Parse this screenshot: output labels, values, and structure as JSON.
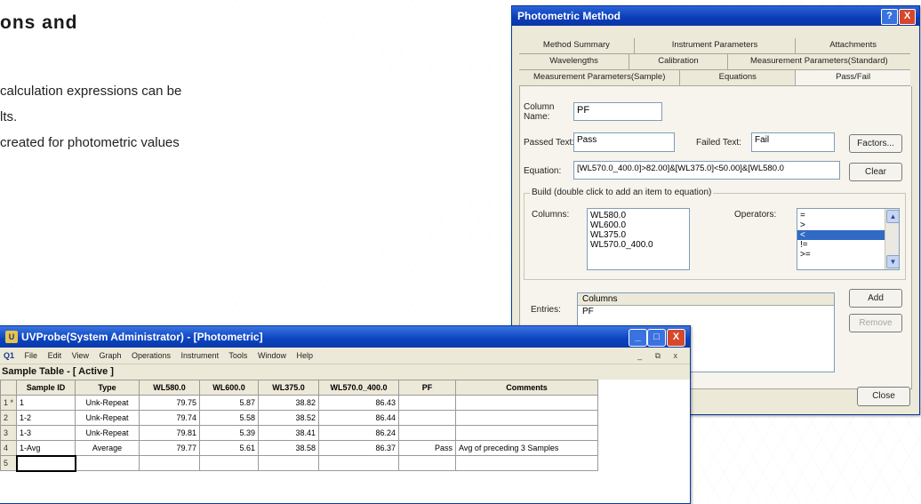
{
  "left": {
    "heading": "ons and",
    "lines": [
      "calculation expressions can be",
      "lts.",
      " created for photometric values"
    ]
  },
  "dialog": {
    "title": "Photometric Method",
    "help_glyph": "?",
    "close_glyph": "X",
    "tabs_row1": [
      "Method Summary",
      "Instrument Parameters",
      "Attachments"
    ],
    "tabs_row2": [
      "Wavelengths",
      "Calibration",
      "Measurement Parameters(Standard)"
    ],
    "tabs_row3": [
      "Measurement Parameters(Sample)",
      "Equations",
      "Pass/Fail"
    ],
    "column_name_label": "Column\nName:",
    "column_name_value": "PF",
    "passed_text_label": "Passed Text:",
    "passed_text_value": "Pass",
    "failed_text_label": "Failed Text:",
    "failed_text_value": "Fail",
    "factors_button": "Factors...",
    "equation_label": "Equation:",
    "equation_value": "[WL570.0_400.0]>82.00]&[WL375.0]<50.00]&[WL580.0",
    "clear_button": "Clear",
    "build_group_title": "Build (double click to add an item to equation)",
    "columns_label": "Columns:",
    "columns_items": [
      "WL580.0",
      "WL600.0",
      "WL375.0",
      "WL570.0_400.0"
    ],
    "operators_label": "Operators:",
    "operators_items": [
      "=",
      ">",
      "<",
      "!=",
      ">="
    ],
    "operators_selected": "<",
    "entries_label": "Entries:",
    "entries_header": "Columns",
    "entries_items": [
      "PF"
    ],
    "add_button": "Add",
    "remove_button": "Remove",
    "close_button": "Close"
  },
  "uvprobe": {
    "title": "UVProbe(System Administrator) - [Photometric]",
    "app_icon_glyph": "U",
    "minimize_glyph": "_",
    "maximize_glyph": "□",
    "close_glyph": "X",
    "menu": [
      "File",
      "Edit",
      "View",
      "Graph",
      "Operations",
      "Instrument",
      "Tools",
      "Window",
      "Help"
    ],
    "menu_icon": "Q1",
    "mdi_controls": "_ ⧉ x",
    "sheet_title": "Sample Table - [ Active ]",
    "columns": [
      "",
      "Sample ID",
      "Type",
      "WL580.0",
      "WL600.0",
      "WL375.0",
      "WL570.0_400.0",
      "PF",
      "Comments"
    ],
    "rows": [
      [
        "1 *",
        "1",
        "Unk-Repeat",
        "79.75",
        "5.87",
        "38.82",
        "86.43",
        "",
        ""
      ],
      [
        "2",
        "1-2",
        "Unk-Repeat",
        "79.74",
        "5.58",
        "38.52",
        "86.44",
        "",
        ""
      ],
      [
        "3",
        "1-3",
        "Unk-Repeat",
        "79.81",
        "5.39",
        "38.41",
        "86.24",
        "",
        ""
      ],
      [
        "4",
        "1-Avg",
        "Average",
        "79.77",
        "5.61",
        "38.58",
        "86.37",
        "Pass",
        "Avg of preceding 3 Samples"
      ],
      [
        "5",
        "",
        "",
        "",
        "",
        "",
        "",
        "",
        ""
      ]
    ]
  }
}
